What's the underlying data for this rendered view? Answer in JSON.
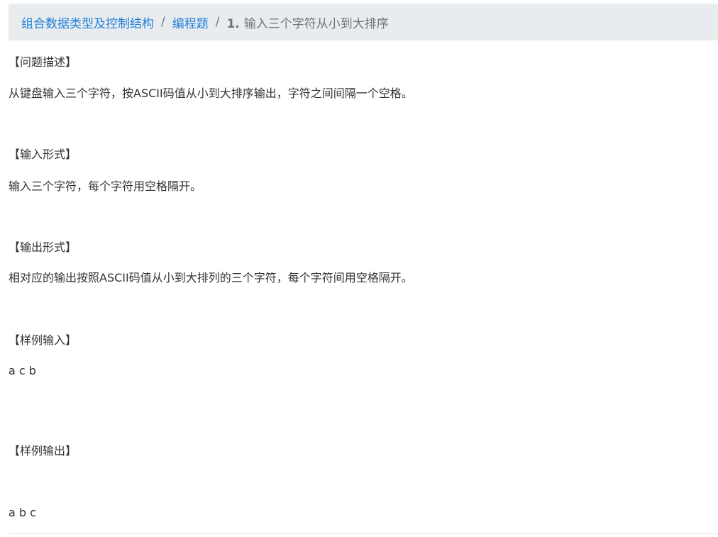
{
  "breadcrumb": {
    "items": [
      {
        "label": "组合数据类型及控制结构"
      },
      {
        "label": "编程题"
      }
    ],
    "separator": "/",
    "current_number": "1.",
    "current_title": "输入三个字符从小到大排序"
  },
  "problem": {
    "description_heading": "【问题描述】",
    "description_text": " 从键盘输入三个字符，按ASCII码值从小到大排序输出，字符之间间隔一个空格。",
    "input_heading": "【输入形式】",
    "input_text": "输入三个字符，每个字符用空格隔开。",
    "output_heading": "【输出形式】",
    "output_text": "相对应的输出按照ASCII码值从小到大排列的三个字符，每个字符间用空格隔开。",
    "sample_input_heading": "【样例输入】",
    "sample_input": "a c b",
    "sample_output_heading": "【样例输出】",
    "sample_output": "a b c"
  }
}
